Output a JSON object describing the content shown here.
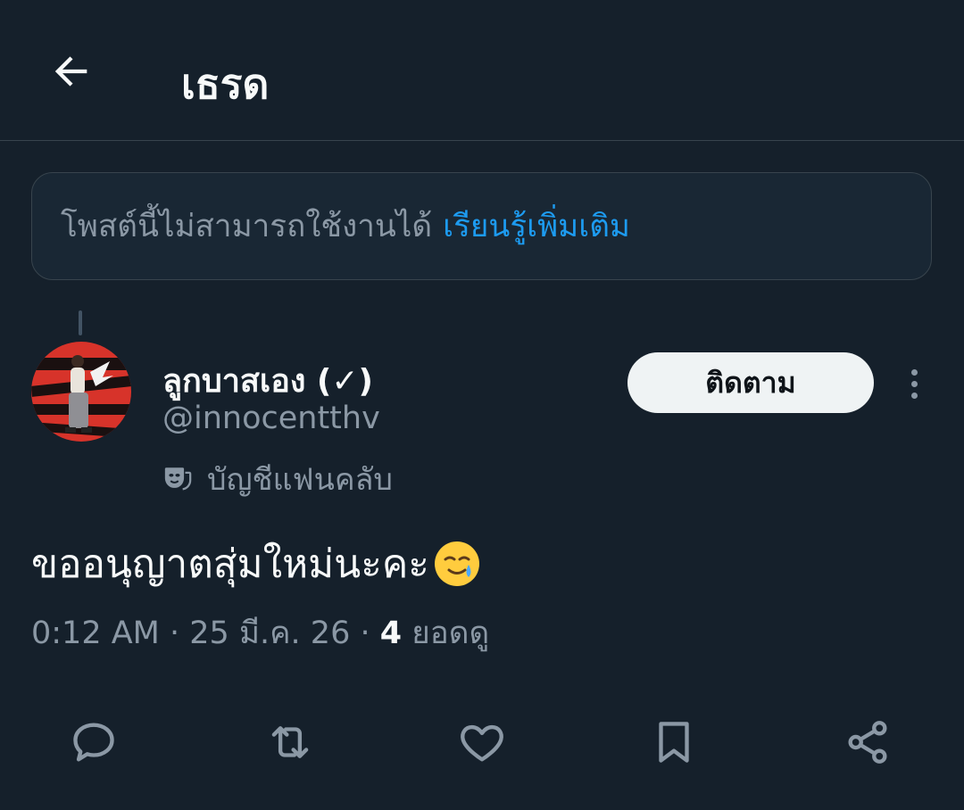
{
  "header": {
    "title": "เธรด",
    "back_icon": "arrow-left-icon"
  },
  "notice": {
    "text": "โพสต์นี้ไม่สามารถใช้งานได้",
    "link": "เรียนรู้เพิ่มเติม"
  },
  "author": {
    "display_name": "ลูกบาสเอง (✓)",
    "handle": "@innocentthv",
    "fan_label": "บัญชีแฟนคลับ",
    "fan_icon": "theater-mask-icon"
  },
  "follow_label": "ติดตาม",
  "tweet": {
    "text": "ขออนุญาตสุ่มใหม่นะคะ",
    "emoji": "smiling-face-with-tear"
  },
  "meta": {
    "time": "0:12 AM",
    "date": "25 มี.ค. 26",
    "views_count": "4",
    "views_label": "ยอดดู"
  },
  "actions": [
    "reply-icon",
    "repost-icon",
    "like-icon",
    "bookmark-icon",
    "share-icon"
  ],
  "colors": {
    "background": "#15202b",
    "accent": "#1d9bf0",
    "muted": "#8b98a5",
    "border": "#38444d"
  }
}
